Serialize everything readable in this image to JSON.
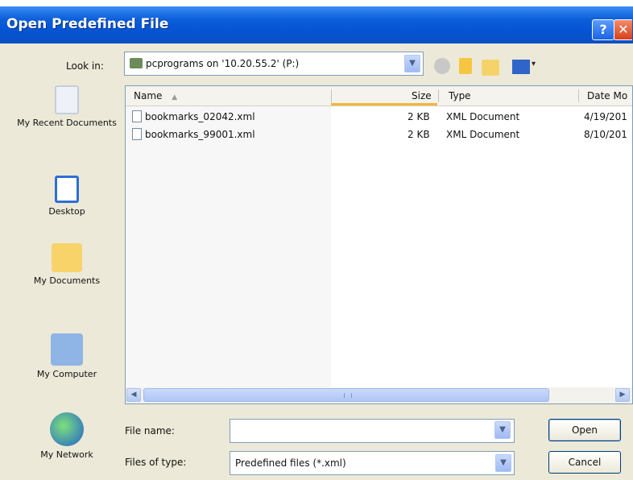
{
  "window": {
    "title": "Open Predefined File",
    "help_glyph": "?",
    "close_glyph": "✕"
  },
  "toolbar": {
    "look_in_label": "Look in:",
    "look_in_value": "pcprograms on '10.20.55.2' (P:)",
    "icons": [
      "back-icon",
      "up-folder-icon",
      "new-folder-icon",
      "views-icon"
    ]
  },
  "places": [
    {
      "label": "My Recent Documents",
      "icon": "recent-documents-icon"
    },
    {
      "label": "Desktop",
      "icon": "desktop-icon"
    },
    {
      "label": "My Documents",
      "icon": "documents-folder-icon"
    },
    {
      "label": "My Computer",
      "icon": "computer-icon"
    },
    {
      "label": "My Network",
      "icon": "network-icon"
    }
  ],
  "file_list": {
    "columns": {
      "name": "Name",
      "size": "Size",
      "type": "Type",
      "date": "Date Mo"
    },
    "sort_indicator": "▲",
    "rows": [
      {
        "name": "bookmarks_02042.xml",
        "size": "2 KB",
        "type": "XML Document",
        "date": "4/19/201"
      },
      {
        "name": "bookmarks_99001.xml",
        "size": "2 KB",
        "type": "XML Document",
        "date": "8/10/201"
      }
    ]
  },
  "form": {
    "file_name_label": "File name:",
    "file_name_value": "",
    "file_type_label": "Files of type:",
    "file_type_value": "Predefined files (*.xml)"
  },
  "buttons": {
    "open": "Open",
    "cancel": "Cancel"
  },
  "glyphs": {
    "down_arrow": "▼",
    "left_arrow": "◀",
    "right_arrow": "▶",
    "small_down": "▾"
  }
}
